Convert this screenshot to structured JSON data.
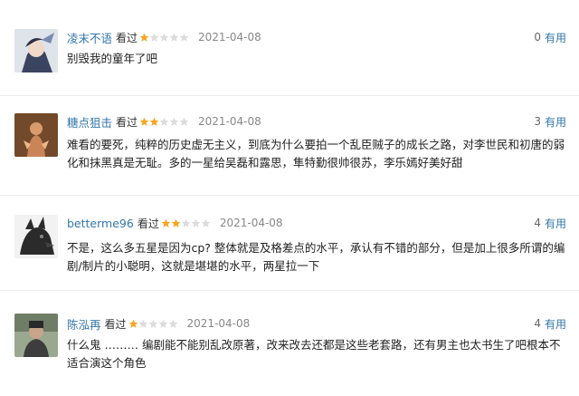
{
  "reviews": [
    {
      "user": "凌末不语",
      "watched": "看过",
      "rating": 1,
      "date": "2021-04-08",
      "useful_count": "0",
      "useful_label": "有用",
      "text": "别毁我的童年了吧",
      "star_color": "#f5a623"
    },
    {
      "user": "糖点狙击",
      "watched": "看过",
      "rating": 2,
      "date": "2021-04-08",
      "useful_count": "3",
      "useful_label": "有用",
      "text": "难看的要死，纯粹的历史虚无主义，到底为什么要拍一个乱臣贼子的成长之路，对李世民和初唐的弱化和抹黑真是无耻。多的一星给吴磊和露思，隼特勤很帅很苏，李乐嫣好美好甜",
      "star_color": "#f5a623"
    },
    {
      "user": "betterme96",
      "watched": "看过",
      "rating": 2,
      "date": "2021-04-08",
      "useful_count": "4",
      "useful_label": "有用",
      "text": "不是，这么多五星是因为cp?  整体就是及格差点的水平，承认有不错的部分，但是加上很多所谓的编剧/制片的小聪明，这就是堪堪的水平，两星拉一下",
      "star_color": "#f5a623"
    },
    {
      "user": "陈泓再",
      "watched": "看过",
      "rating": 1,
      "date": "2021-04-08",
      "useful_count": "4",
      "useful_label": "有用",
      "text": "什么鬼 ……… 编剧能不能别乱改原著，改来改去还都是这些老套路，还有男主也太书生了吧根本不适合演这个角色",
      "star_color": "#f5a623"
    }
  ]
}
